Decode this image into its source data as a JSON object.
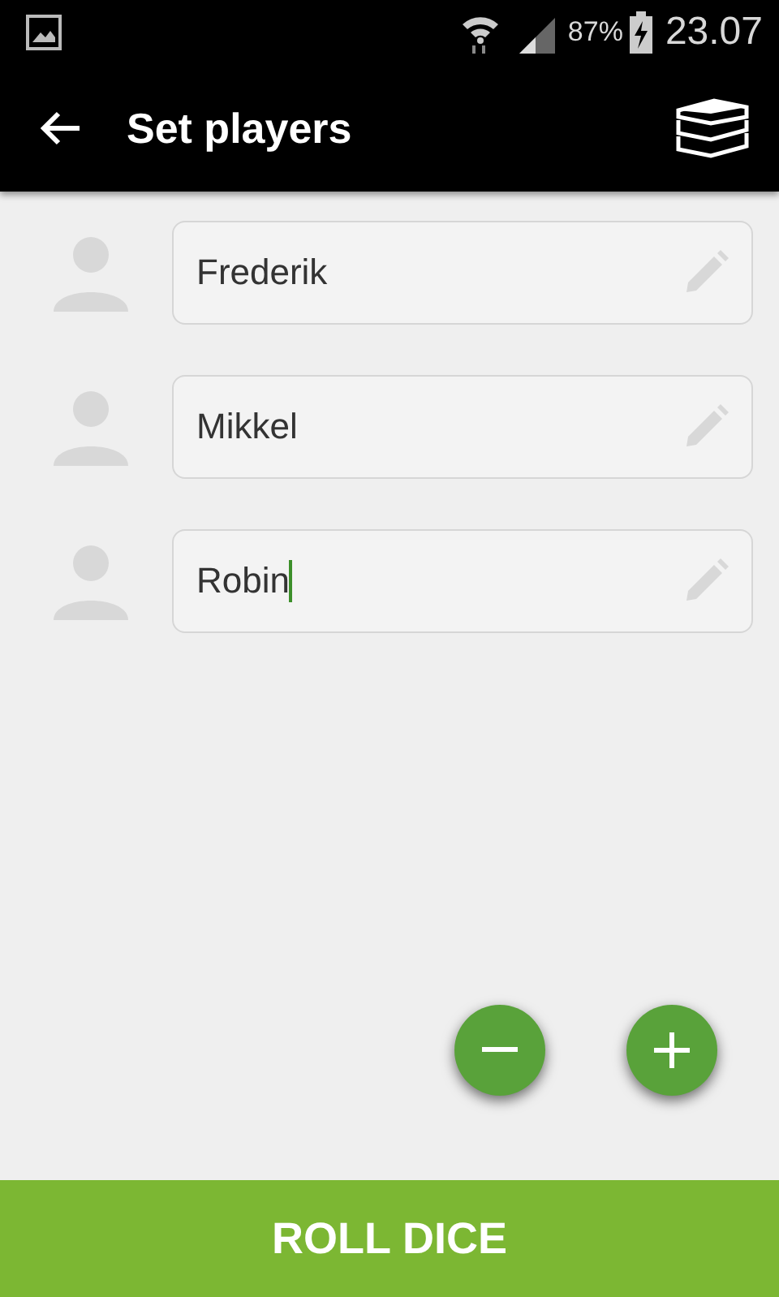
{
  "status_bar": {
    "battery": "87%",
    "time": "23.07"
  },
  "app_bar": {
    "title": "Set players"
  },
  "players": [
    {
      "name": "Frederik",
      "focused": false
    },
    {
      "name": "Mikkel",
      "focused": false
    },
    {
      "name": "Robin",
      "focused": true
    }
  ],
  "bottom_button": {
    "label": "ROLL DICE"
  }
}
